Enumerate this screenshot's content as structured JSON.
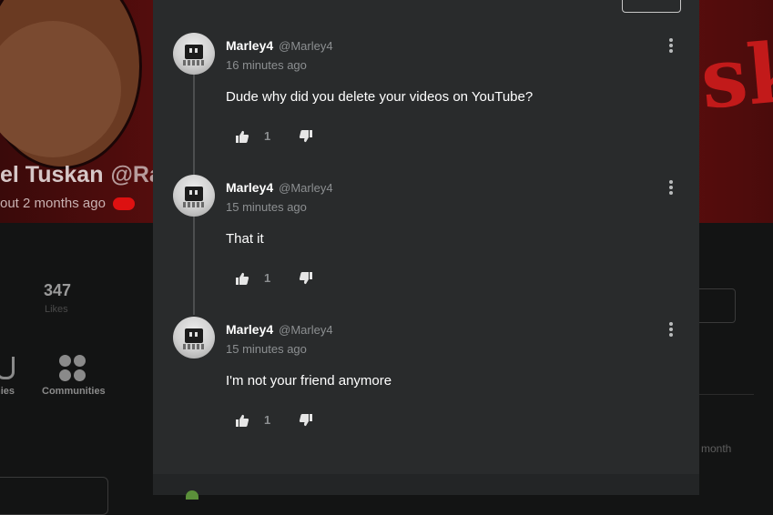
{
  "background": {
    "name": "el Tuskan",
    "handle": "@Rat",
    "joined": "out 2 months ago",
    "likes_count": "347",
    "likes_label": "Likes",
    "communities_label": "Communities",
    "games_label": "nies",
    "scribble_text": "sk",
    "month_text": "month"
  },
  "comments": [
    {
      "username": "Marley4",
      "handle": "@Marley4",
      "time": "16 minutes ago",
      "text": "Dude why did you delete your videos on YouTube?",
      "likes": "1"
    },
    {
      "username": "Marley4",
      "handle": "@Marley4",
      "time": "15 minutes ago",
      "text": "That it",
      "likes": "1"
    },
    {
      "username": "Marley4",
      "handle": "@Marley4",
      "time": "15 minutes ago",
      "text": "I'm not your friend anymore",
      "likes": "1"
    }
  ],
  "icons": {
    "like": "thumbs-up-icon",
    "dislike": "thumbs-down-icon",
    "menu": "more-vertical-icon"
  },
  "colors": {
    "panel": "#292b2c",
    "page": "#131414",
    "text": "#ffffff",
    "muted": "#8c8f91",
    "banner": "#7a1212"
  }
}
